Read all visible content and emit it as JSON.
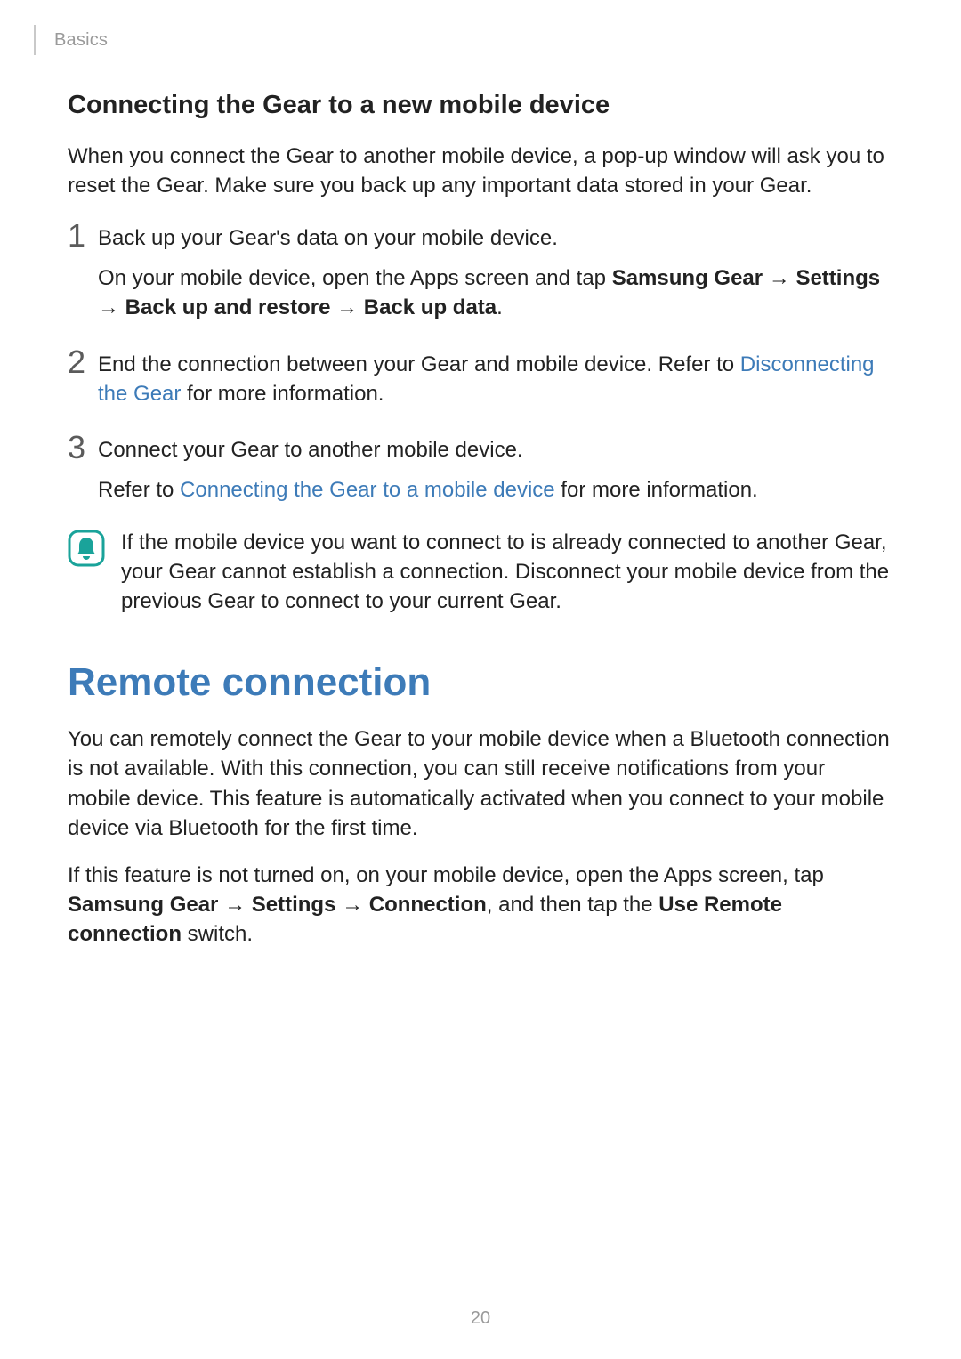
{
  "header": {
    "section": "Basics"
  },
  "heading1": "Connecting the Gear to a new mobile device",
  "intro": "When you connect the Gear to another mobile device, a pop-up window will ask you to reset the Gear. Make sure you back up any important data stored in your Gear.",
  "steps": {
    "s1": {
      "num": "1",
      "line1": "Back up your Gear's data on your mobile device.",
      "line2a": "On your mobile device, open the Apps screen and tap ",
      "b1": "Samsung Gear",
      "a1": " → ",
      "b2": "Settings",
      "a2": " → ",
      "b3": "Back up and restore",
      "a3": " → ",
      "b4": "Back up data",
      "end": "."
    },
    "s2": {
      "num": "2",
      "line1a": "End the connection between your Gear and mobile device. Refer to ",
      "link": "Disconnecting the Gear",
      "line1b": " for more information."
    },
    "s3": {
      "num": "3",
      "line1": "Connect your Gear to another mobile device.",
      "line2a": "Refer to ",
      "link": "Connecting the Gear to a mobile device",
      "line2b": " for more information."
    }
  },
  "note": "If the mobile device you want to connect to is already connected to another Gear, your Gear cannot establish a connection. Disconnect your mobile device from the previous Gear to connect to your current Gear.",
  "heading2": "Remote connection",
  "remote_p1": "You can remotely connect the Gear to your mobile device when a Bluetooth connection is not available. With this connection, you can still receive notifications from your mobile device. This feature is automatically activated when you connect to your mobile device via Bluetooth for the first time.",
  "remote_p2": {
    "t1": "If this feature is not turned on, on your mobile device, open the Apps screen, tap ",
    "b1": "Samsung Gear",
    "a1": " → ",
    "b2": "Settings",
    "a2": " → ",
    "b3": "Connection",
    "t2": ", and then tap the ",
    "b4": "Use Remote connection",
    "t3": " switch."
  },
  "page": "20",
  "icons": {
    "note": "bell-icon"
  }
}
